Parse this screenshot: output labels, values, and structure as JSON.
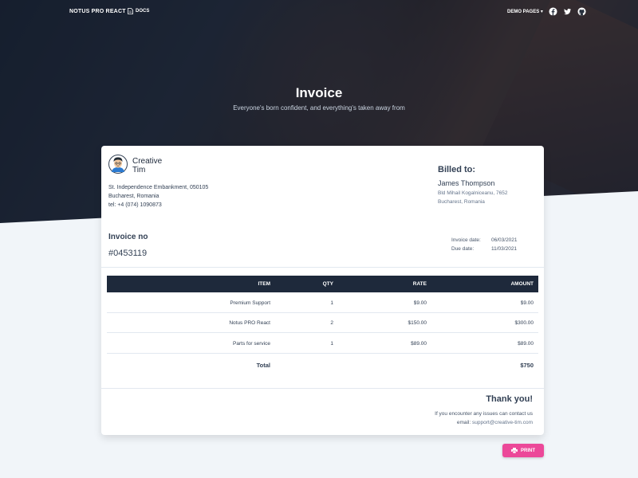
{
  "nav": {
    "brand": "NOTUS PRO REACT",
    "docs_label": "DOCS",
    "demo_label": "DEMO PAGES",
    "social_icons": [
      "facebook-icon",
      "twitter-icon",
      "github-icon"
    ]
  },
  "hero": {
    "title": "Invoice",
    "subtitle": "Everyone's born confident, and everything's taken away from"
  },
  "company": {
    "name_line1": "Creative",
    "name_line2": "Tim",
    "address_line1": "St. Independence Embankment, 050105",
    "address_line2": "Bucharest, Romania",
    "phone": "tel: +4 (074) 1090873"
  },
  "billed": {
    "title": "Billed to:",
    "name": "James Thompson",
    "address_line1": "Bld Mihail Kogalniceanu, 7652",
    "address_line2": "Bucharest, Romania"
  },
  "invoice": {
    "label": "Invoice no",
    "number": "#0453119",
    "date_label": "Invoice date:",
    "date_value": "06/03/2021",
    "due_label": "Due date:",
    "due_value": "11/03/2021"
  },
  "table": {
    "headers": {
      "item": "ITEM",
      "qty": "QTY",
      "rate": "RATE",
      "amount": "AMOUNT"
    },
    "rows": [
      {
        "item": "Premium Support",
        "qty": "1",
        "rate": "$9.00",
        "amount": "$9.00"
      },
      {
        "item": "Notus PRO React",
        "qty": "2",
        "rate": "$150.00",
        "amount": "$300.00"
      },
      {
        "item": "Parts for service",
        "qty": "1",
        "rate": "$89.00",
        "amount": "$89.00"
      }
    ],
    "total_label": "Total",
    "total_value": "$750"
  },
  "footer": {
    "thanks": "Thank you!",
    "contact_line": "If you encounter any issues can contact us",
    "email_label": "email:",
    "email": "support@creative-tim.com"
  },
  "print_label": "PRINT",
  "colors": {
    "accent": "#ec4899",
    "header_dark": "#1e293b",
    "background": "#f1f5f9"
  }
}
